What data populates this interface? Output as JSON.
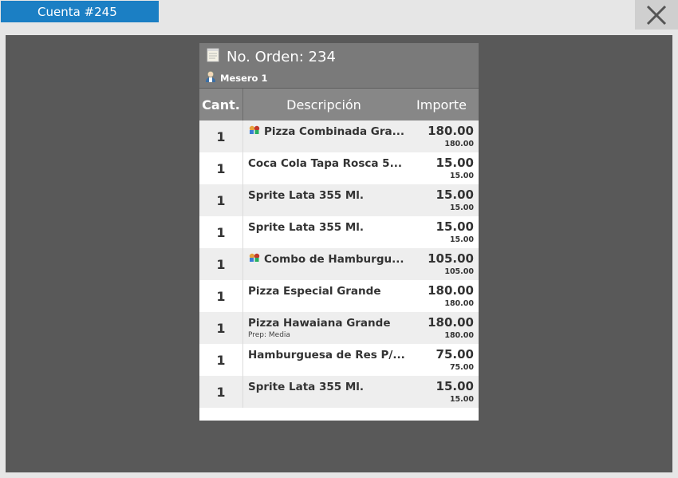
{
  "header": {
    "account_tab": "Cuenta #245",
    "close_icon": "close-x-icon"
  },
  "ticket": {
    "order_title": "No. Orden: 234",
    "order_icon": "notepad-icon",
    "waiter": "Mesero 1",
    "waiter_icon": "waiter-person-icon",
    "columns": {
      "qty": "Cant.",
      "desc": "Descripción",
      "amount": "Importe"
    },
    "items": [
      {
        "qty": "1",
        "name": "Pizza Combinada Gra...",
        "combo": true,
        "prep": "",
        "amount": "180.00",
        "sub": "180.00"
      },
      {
        "qty": "1",
        "name": "Coca Cola Tapa Rosca 5...",
        "combo": false,
        "prep": "",
        "amount": "15.00",
        "sub": "15.00"
      },
      {
        "qty": "1",
        "name": "Sprite Lata 355 Ml.",
        "combo": false,
        "prep": "",
        "amount": "15.00",
        "sub": "15.00"
      },
      {
        "qty": "1",
        "name": "Sprite Lata 355 Ml.",
        "combo": false,
        "prep": "",
        "amount": "15.00",
        "sub": "15.00"
      },
      {
        "qty": "1",
        "name": "Combo de Hamburgu...",
        "combo": true,
        "prep": "",
        "amount": "105.00",
        "sub": "105.00"
      },
      {
        "qty": "1",
        "name": "Pizza Especial Grande",
        "combo": false,
        "prep": "",
        "amount": "180.00",
        "sub": "180.00"
      },
      {
        "qty": "1",
        "name": "Pizza Hawaiana Grande",
        "combo": false,
        "prep": "Prep: Media",
        "amount": "180.00",
        "sub": "180.00"
      },
      {
        "qty": "1",
        "name": "Hamburguesa de Res P/...",
        "combo": false,
        "prep": "",
        "amount": "75.00",
        "sub": "75.00"
      },
      {
        "qty": "1",
        "name": "Sprite Lata 355 Ml.",
        "combo": false,
        "prep": "",
        "amount": "15.00",
        "sub": "15.00"
      }
    ]
  },
  "colors": {
    "accent": "#1b7fc4",
    "stage": "#595959",
    "ticket_header": "#7a7a7a",
    "column_header": "#878787"
  }
}
